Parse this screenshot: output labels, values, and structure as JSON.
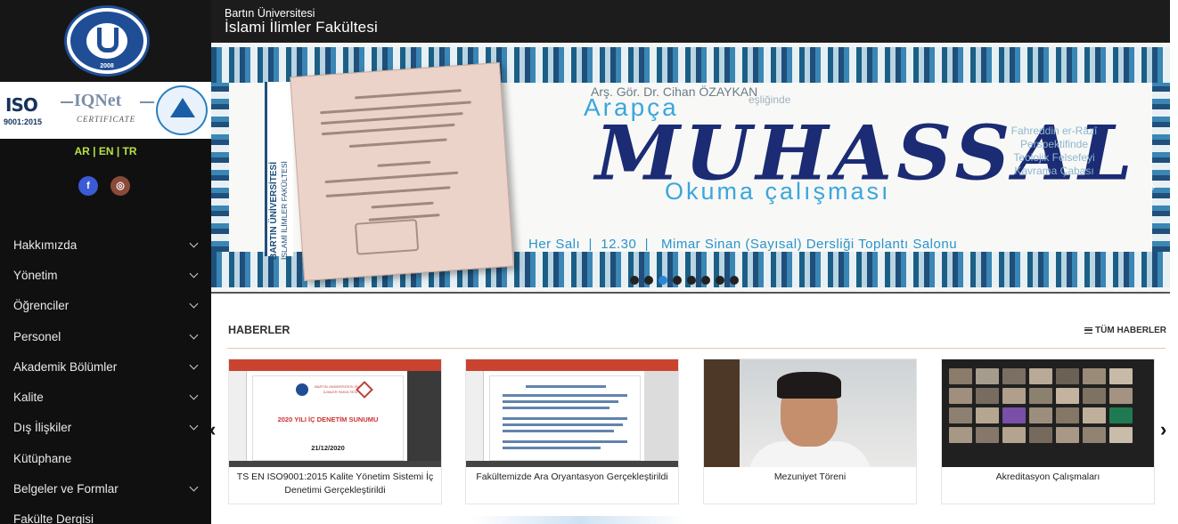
{
  "header": {
    "university": "Bartın Üniversitesi",
    "faculty": "İslami İlimler Fakültesi"
  },
  "logo": {
    "year": "2008"
  },
  "certificates": {
    "iso": "ISO",
    "iso_number": "9001:2015",
    "iqnet": "IQNet",
    "iqnet_sub": "CERTIFICATE"
  },
  "languages": {
    "ar": "AR",
    "en": "EN",
    "tr": "TR",
    "sep": "|"
  },
  "social": {
    "facebook": "f",
    "instagram": "◎"
  },
  "menu": [
    {
      "label": "Hakkımızda",
      "expandable": true
    },
    {
      "label": "Yönetim",
      "expandable": true
    },
    {
      "label": "Öğrenciler",
      "expandable": true
    },
    {
      "label": "Personel",
      "expandable": true
    },
    {
      "label": "Akademik Bölümler",
      "expandable": true
    },
    {
      "label": "Kalite",
      "expandable": true
    },
    {
      "label": "Dış İlişkiler",
      "expandable": true
    },
    {
      "label": "Kütüphane",
      "expandable": false
    },
    {
      "label": "Belgeler ve Formlar",
      "expandable": true
    },
    {
      "label": "Fakülte Dergisi",
      "expandable": false
    }
  ],
  "slide": {
    "band_title": "BARTIN ÜNİVERSİTESİ",
    "band_subtitle": "İSLAMİ İLİMLER FAKÜLTESİ",
    "speaker": "Arş. Gör. Dr. Cihan ÖZAYKAN",
    "escort": "eşliğinde",
    "lang": "Arapça",
    "title": "MUHASSAL",
    "subtitle": "Okuma çalışması",
    "side_text": [
      "Fahreddin er-Râzî",
      "Perspektifinde",
      "Teolojik Felsefeyi",
      "Kavrama Çabası"
    ],
    "schedule": "Her Salı  |  12.30  |   Mimar Sinan (Sayısal) Dersliği Toplantı Salonu",
    "dot_count": 8,
    "active_dot": 2
  },
  "news": {
    "heading": "HABERLER",
    "all_label": "TÜM HABERLER",
    "items": [
      {
        "caption": "TS EN ISO9001:2015 Kalite Yönetim Sistemi İç Denetimi Gerçekleştirildi",
        "slide_head": "BARTIN ÜNİVERSİTESİ İSLAMİ İLİMLER FAKÜLTESİ",
        "slide_title": "2020 YILI İÇ DENETİM SUNUMU",
        "slide_date": "21/12/2020"
      },
      {
        "caption": "Fakültemizde Ara Oryantasyon Gerçekleştirildi"
      },
      {
        "caption": "Mezuniyet Töreni"
      },
      {
        "caption": "Akreditasyon Çalışmaları"
      }
    ]
  },
  "colors": {
    "sidebar_bg": "#101010",
    "header_bg": "#1c1c1c",
    "lang_accent": "#b8e04a",
    "facebook": "#3b5bd5",
    "active_dot": "#2d86d6",
    "title_navy": "#1b2b74",
    "accent_blue": "#3ba6dd"
  },
  "icons": {
    "menu_chevron": "chevron-down-icon",
    "slider_prev": "chevron-left-icon",
    "slider_next": "chevron-right-icon",
    "news_prev": "chevron-left-icon",
    "news_next": "chevron-right-icon",
    "all_news": "list-icon"
  }
}
